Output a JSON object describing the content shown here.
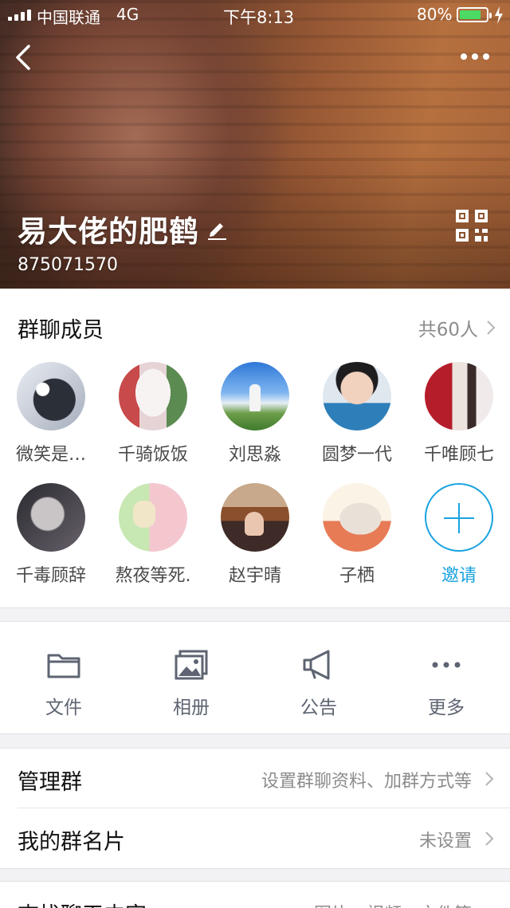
{
  "status_bar": {
    "carrier": "中国联通",
    "network": "4G",
    "time": "下午8:13",
    "battery_percent": "80%",
    "battery_level": 0.8,
    "signal_bars": 4
  },
  "header": {
    "back_icon": "chevron-left-icon",
    "more_icon": "ellipsis-icon",
    "group_name": "易大佬的肥鹤",
    "edit_icon": "pencil-icon",
    "group_id": "875071570",
    "qr_icon": "qr-code-icon"
  },
  "members_section": {
    "title": "群聊成员",
    "count_text": "共60人",
    "members": [
      {
        "name": "微笑是…"
      },
      {
        "name": "千骑饭饭"
      },
      {
        "name": "刘思淼"
      },
      {
        "name": "圆梦一代"
      },
      {
        "name": "千唯顾七"
      },
      {
        "name": "千毒顾辞"
      },
      {
        "name": "熬夜等死."
      },
      {
        "name": "赵宇晴"
      },
      {
        "name": "子栖"
      }
    ],
    "invite_label": "邀请",
    "accent_color": "#1aa3e0"
  },
  "actions": [
    {
      "label": "文件",
      "icon": "folder-icon"
    },
    {
      "label": "相册",
      "icon": "photo-album-icon"
    },
    {
      "label": "公告",
      "icon": "megaphone-icon"
    },
    {
      "label": "更多",
      "icon": "ellipsis-icon"
    }
  ],
  "settings": [
    {
      "title": "管理群",
      "value": "设置群聊资料、加群方式等"
    },
    {
      "title": "我的群名片",
      "value": "未设置"
    }
  ],
  "search_row": {
    "title": "查找聊天内容",
    "value": "图片、视频、文件等"
  }
}
